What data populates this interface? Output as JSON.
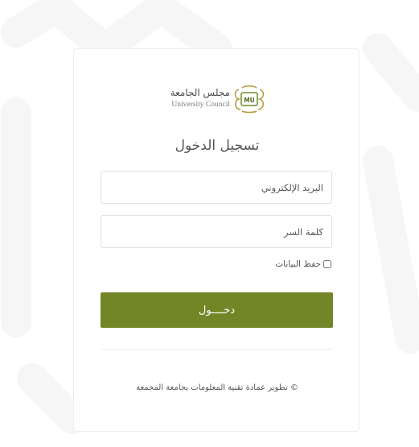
{
  "logo": {
    "title_ar": "مجلس الجامعة",
    "title_en": "University Council",
    "emblem_text": "MU",
    "emblem_icon": "university-emblem-icon"
  },
  "form": {
    "title": "تسجيل الدخول",
    "email_placeholder": "البريد الإلكتروني",
    "password_placeholder": "كلمة السر",
    "remember_label": "حفظ البيانات",
    "remember_checked": false,
    "login_label": "دخــــول"
  },
  "footer": {
    "text": "© تطوير عمادة تقنية المعلومات بجامعة المجمعة"
  },
  "colors": {
    "accent": "#728628",
    "emblem_gold": "#b99b3e",
    "emblem_green": "#6f8a2a"
  }
}
